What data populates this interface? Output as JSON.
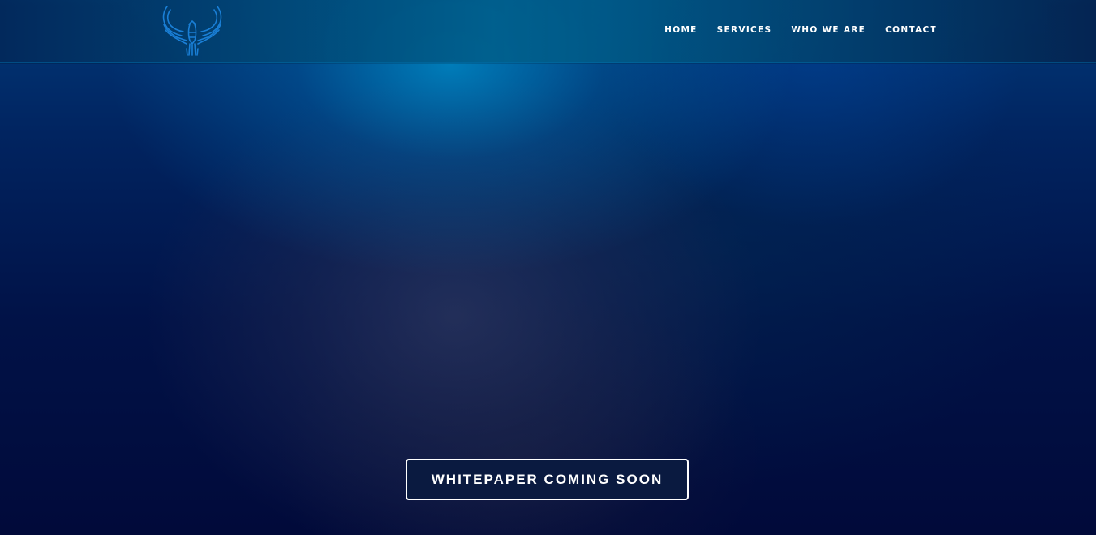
{
  "header": {
    "logo": {
      "icon": "eagle-logo-icon",
      "color": "#1a7fd6"
    },
    "nav": [
      {
        "label": "HOME"
      },
      {
        "label": "SERVICES"
      },
      {
        "label": "WHO WE ARE"
      },
      {
        "label": "CONTACT"
      }
    ]
  },
  "hero": {
    "cta_label": "WHITEPAPER COMING SOON"
  },
  "colors": {
    "header_bg": "#005f8c",
    "hero_bg": "#010a3a",
    "nav_text": "#ffffff",
    "button_border": "#ffffff"
  }
}
